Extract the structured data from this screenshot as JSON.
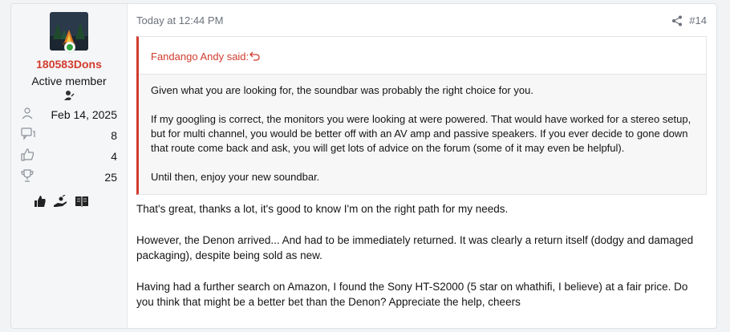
{
  "user": {
    "name": "180583Dons",
    "title": "Active member",
    "online": true,
    "stats": [
      {
        "icon": "user-icon",
        "value": "Feb 14, 2025"
      },
      {
        "icon": "messages-icon",
        "value": "8"
      },
      {
        "icon": "reactions-icon",
        "value": "4"
      },
      {
        "icon": "trophy-icon",
        "value": "25"
      }
    ],
    "trophy_icons": [
      "thumbs-up-icon",
      "hand-icon",
      "book-icon"
    ]
  },
  "post": {
    "date": "Today at 12:44 PM",
    "number": "#14",
    "quote": {
      "author_line": "Fandango Andy said:",
      "paragraphs": [
        "Given what you are looking for, the soundbar was probably the right choice for you.",
        "If my googling is correct, the monitors you were looking at were powered. That would have worked for a stereo setup, but for multi channel, you would be better off with an AV amp and passive speakers. If you ever decide to gone down that route come back and ask, you will get lots of advice on the forum (some of it may even be helpful).",
        "Until then, enjoy your new soundbar."
      ]
    },
    "paragraphs": [
      "That's great, thanks a lot, it's good to know I'm on the right path for my needs.",
      "However, the Denon arrived... And had to be immediately returned. It was clearly a return itself (dodgy and damaged packaging), despite being sold as new.",
      "Having had a further search on Amazon, I found the Sony HT-S2000 (5 star on whathifi, I believe) at a fair price. Do you think that might be a better bet than the Denon? Appreciate the help, cheers"
    ]
  },
  "colors": {
    "accent": "#d13c2e",
    "online": "#2fa23e",
    "muted": "#6b717c"
  }
}
